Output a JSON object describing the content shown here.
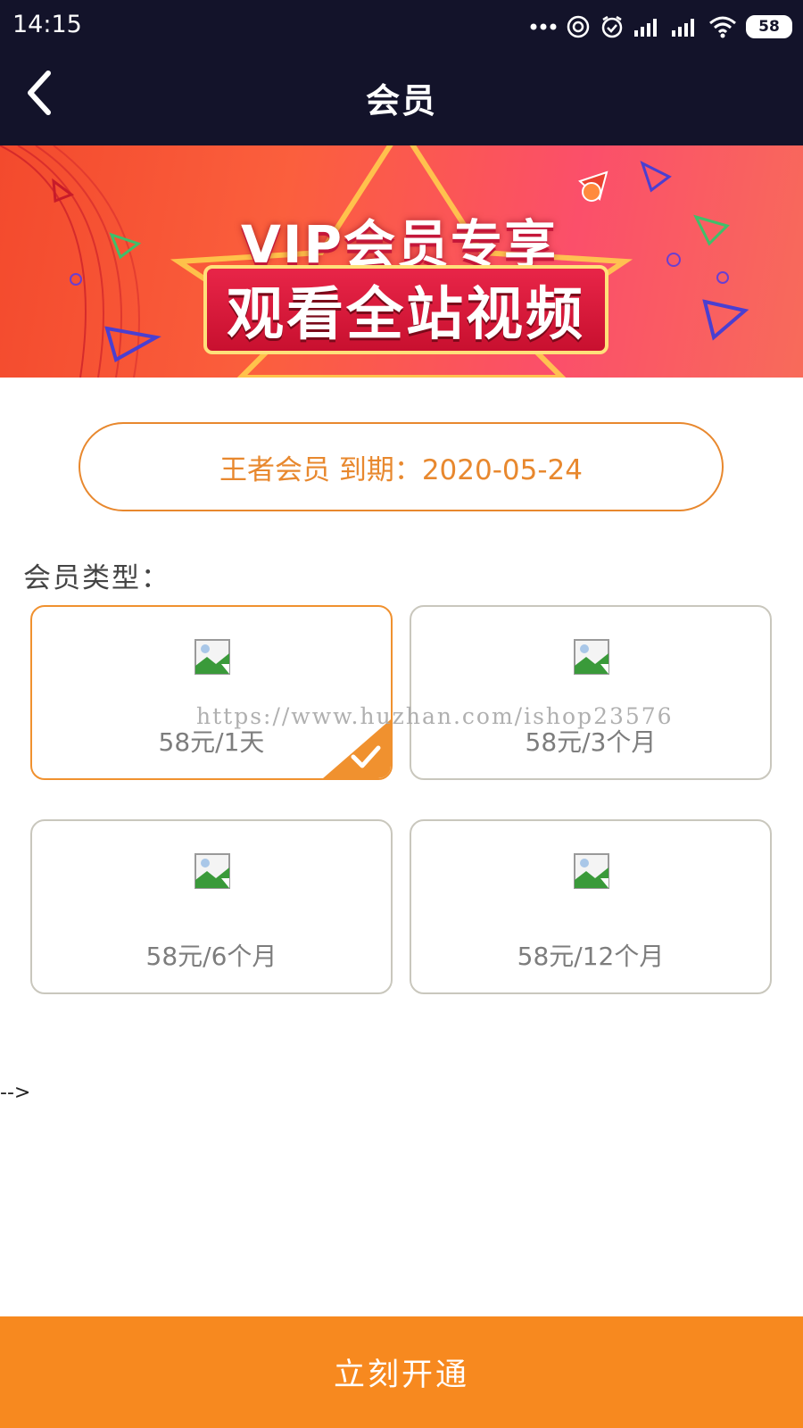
{
  "status_bar": {
    "time": "14:15",
    "battery": "58"
  },
  "header": {
    "title": "会员"
  },
  "banner": {
    "line1": "VIP会员专享",
    "line2": "观看全站视频"
  },
  "membership": {
    "status_text": "王者会员 到期：2020-05-24"
  },
  "plans": {
    "section_label": "会员类型：",
    "items": [
      {
        "label": "58元/1天",
        "selected": true
      },
      {
        "label": "58元/3个月",
        "selected": false
      },
      {
        "label": "58元/6个月",
        "selected": false
      },
      {
        "label": "58元/12个月",
        "selected": false
      }
    ]
  },
  "watermark": "https://www.huzhan.com/ishop23576",
  "stray_text": "-->",
  "footer": {
    "button_label": "立刻开通"
  },
  "colors": {
    "accent": "#f7891f",
    "header_bg": "#13132a",
    "card_border": "#c9c7bd"
  }
}
